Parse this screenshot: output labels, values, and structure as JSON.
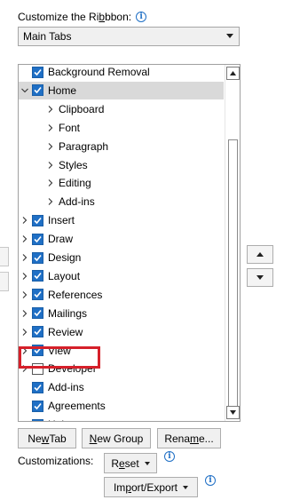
{
  "header": {
    "label_prefix": "Customize the Ri",
    "label_accesskey": "b",
    "label_suffix": "bbon:",
    "info_icon": "i"
  },
  "dropdown": {
    "value": "Main Tabs"
  },
  "tree": {
    "items": [
      {
        "label": "Background Removal",
        "checked": true,
        "level": 0,
        "expander": "none"
      },
      {
        "label": "Home",
        "checked": true,
        "level": 0,
        "expander": "expanded",
        "selected": true
      },
      {
        "label": "Clipboard",
        "level": 1,
        "expander": "collapsed"
      },
      {
        "label": "Font",
        "level": 1,
        "expander": "collapsed"
      },
      {
        "label": "Paragraph",
        "level": 1,
        "expander": "collapsed"
      },
      {
        "label": "Styles",
        "level": 1,
        "expander": "collapsed"
      },
      {
        "label": "Editing",
        "level": 1,
        "expander": "collapsed"
      },
      {
        "label": "Add-ins",
        "level": 1,
        "expander": "collapsed"
      },
      {
        "label": "Insert",
        "checked": true,
        "level": 0,
        "expander": "collapsed"
      },
      {
        "label": "Draw",
        "checked": true,
        "level": 0,
        "expander": "collapsed"
      },
      {
        "label": "Design",
        "checked": true,
        "level": 0,
        "expander": "collapsed"
      },
      {
        "label": "Layout",
        "checked": true,
        "level": 0,
        "expander": "collapsed"
      },
      {
        "label": "References",
        "checked": true,
        "level": 0,
        "expander": "collapsed"
      },
      {
        "label": "Mailings",
        "checked": true,
        "level": 0,
        "expander": "collapsed"
      },
      {
        "label": "Review",
        "checked": true,
        "level": 0,
        "expander": "collapsed"
      },
      {
        "label": "View",
        "checked": true,
        "level": 0,
        "expander": "collapsed"
      },
      {
        "label": "Developer",
        "checked": false,
        "level": 0,
        "expander": "collapsed"
      },
      {
        "label": "Add-ins",
        "checked": true,
        "level": 0,
        "expander": "none"
      },
      {
        "label": "Agreements",
        "checked": true,
        "level": 0,
        "expander": "none"
      },
      {
        "label": "Help",
        "checked": true,
        "level": 0,
        "expander": "collapsed"
      }
    ]
  },
  "buttons": {
    "new_tab_pre": "Ne",
    "new_tab_key": "w",
    "new_tab_post": " Tab",
    "new_group_pre": "",
    "new_group_key": "N",
    "new_group_post": "ew Group",
    "rename_pre": "Rena",
    "rename_key": "m",
    "rename_post": "e...",
    "reset_pre": "R",
    "reset_key": "e",
    "reset_post": "set",
    "import_export_pre": "Im",
    "import_export_key": "p",
    "import_export_post": "ort/Export"
  },
  "customizations_label": "Customizations:",
  "colors": {
    "accent": "#1f6fc5",
    "highlight_border": "#d6202a",
    "selected_row": "#d9d9d9"
  }
}
